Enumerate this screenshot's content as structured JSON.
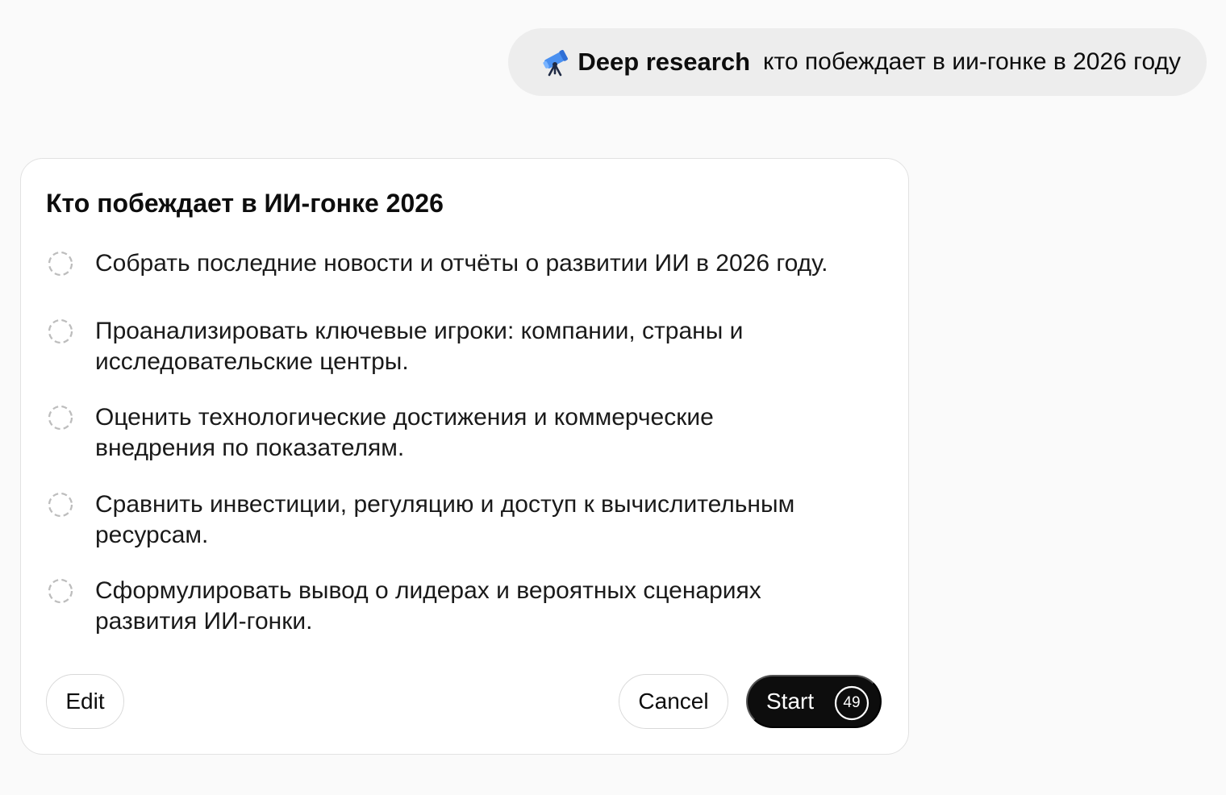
{
  "user_message": {
    "mode_icon": "telescope-icon",
    "mode_label": "Deep research",
    "query": "кто побеждает в ии-гонке в 2026 году"
  },
  "plan": {
    "title": "Кто побеждает в ИИ-гонке 2026",
    "step_icon": "dashed-circle-pending-icon",
    "steps": [
      {
        "text": "Собрать последние новости и отчёты о развитии ИИ в 2026 году."
      },
      {
        "text": "Проанализировать ключевые игроки: компании, страны и исследовательские центры."
      },
      {
        "text": "Оценить технологические достижения и коммерческие внедрения по показателям."
      },
      {
        "text": "Сравнить инвестиции, регуляцию и доступ к вычислительным ресурсам."
      },
      {
        "text": "Сформулировать вывод о лидерах и вероятных сценариях развития ИИ-гонки."
      }
    ]
  },
  "actions": {
    "edit_label": "Edit",
    "cancel_label": "Cancel",
    "start_label": "Start",
    "countdown_value": "49"
  },
  "colors": {
    "page_background": "#fafafa",
    "bubble_background": "#ededed",
    "card_background": "#ffffff",
    "card_border": "#e2e2e2",
    "primary_button": "#0d0d0d",
    "telescope_blue": "#3b82f6"
  }
}
